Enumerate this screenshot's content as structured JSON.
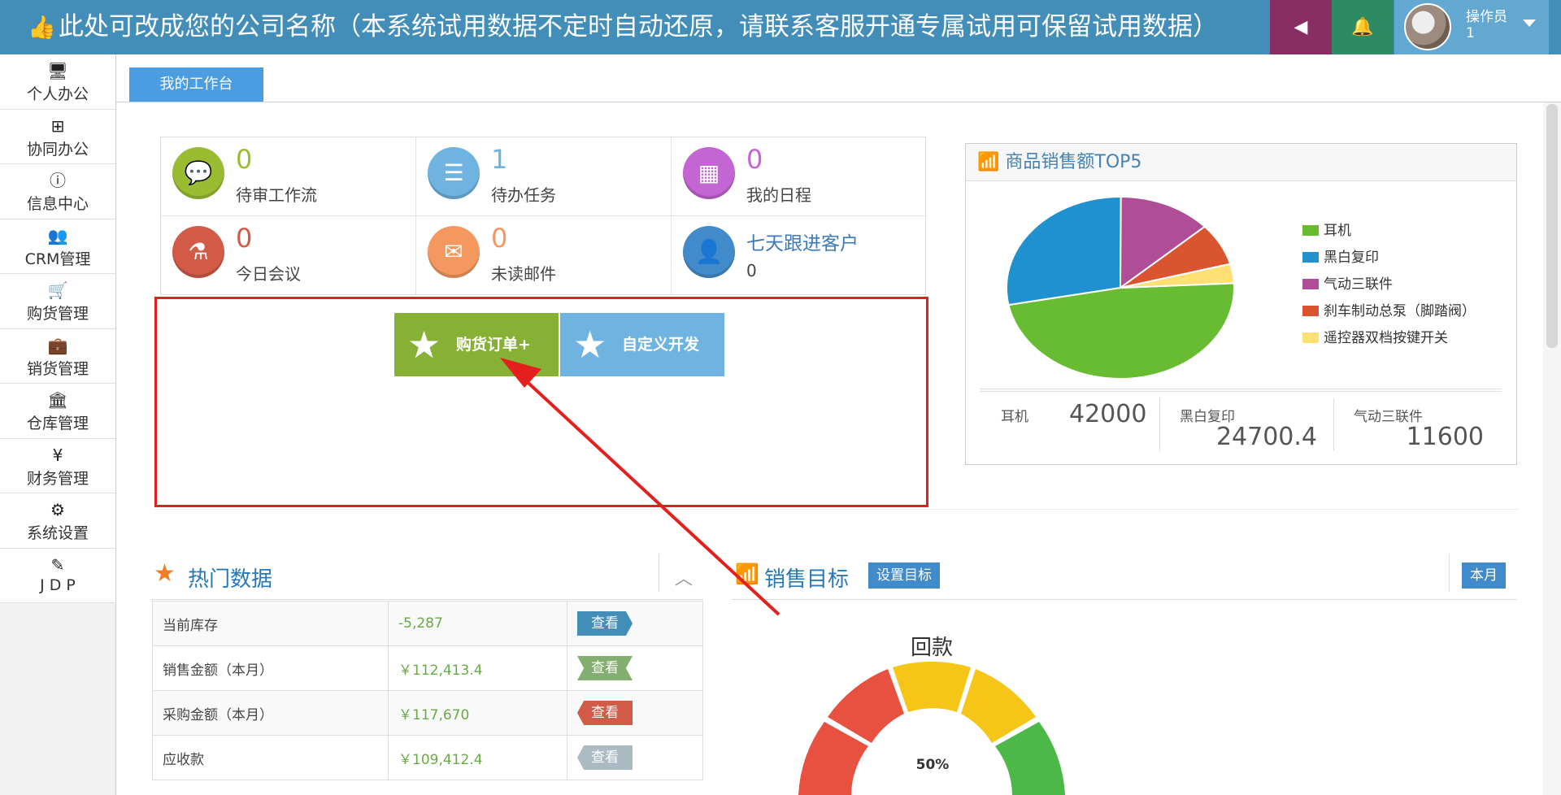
{
  "header": {
    "title": "此处可改成您的公司名称（本系统试用数据不定时自动还原，请联系客服开通专属试用可保留试用数据）",
    "user_name": "操作员",
    "user_id": "1"
  },
  "sidebar": {
    "items": [
      {
        "label": "个人办公",
        "icon": "monitor-icon"
      },
      {
        "label": "协同办公",
        "icon": "sitemap-icon"
      },
      {
        "label": "信息中心",
        "icon": "info-icon"
      },
      {
        "label": "CRM管理",
        "icon": "users-icon"
      },
      {
        "label": "购货管理",
        "icon": "cart-icon"
      },
      {
        "label": "销货管理",
        "icon": "briefcase-icon"
      },
      {
        "label": "仓库管理",
        "icon": "bank-icon"
      },
      {
        "label": "财务管理",
        "icon": "yen-icon"
      },
      {
        "label": "系统设置",
        "icon": "gear-icon"
      },
      {
        "label": "J D P",
        "icon": "edit-icon"
      }
    ]
  },
  "tabs": [
    {
      "label": "我的工作台"
    }
  ],
  "stats": [
    {
      "value": "0",
      "label": "待审工作流",
      "color": "#9abc32"
    },
    {
      "value": "1",
      "label": "待办任务",
      "color": "#6fb3e0"
    },
    {
      "value": "0",
      "label": "我的日程",
      "color": "#c365d2"
    },
    {
      "value": "0",
      "label": "今日会议",
      "color": "#d15b47"
    },
    {
      "value": "0",
      "label": "未读邮件",
      "color": "#f49860"
    },
    {
      "value": "0",
      "label": "七天跟进客户",
      "color": "#428bca"
    }
  ],
  "quick": {
    "purchase_order": "购货订单+",
    "custom_dev": "自定义开发"
  },
  "top5": {
    "title": "商品销售额TOP5",
    "metrics": [
      {
        "name": "耳机",
        "value": "42000"
      },
      {
        "name": "黑白复印",
        "value": "24700.4"
      },
      {
        "name": "气动三联件",
        "value": "11600"
      }
    ]
  },
  "chart_data": {
    "type": "pie",
    "categories": [
      "耳机",
      "黑白复印",
      "气动三联件",
      "刹车制动总泵（脚踏阀）",
      "遥控器双档按键开关"
    ],
    "values": [
      42000,
      24700.4,
      11600,
      6600,
      3000
    ],
    "colors": [
      "#68bc31",
      "#2091cf",
      "#af4e96",
      "#da5430",
      "#fee074"
    ],
    "legend": "right"
  },
  "hot": {
    "title": "热门数据",
    "rows": [
      {
        "name": "当前库存",
        "value": "-5,287",
        "action": "查看"
      },
      {
        "name": "销售金额（本月）",
        "value": "￥112,413.4",
        "action": "查看"
      },
      {
        "name": "采购金额（本月）",
        "value": "￥117,670",
        "action": "查看"
      },
      {
        "name": "应收款",
        "value": "￥109,412.4",
        "action": "查看"
      }
    ]
  },
  "sales_target": {
    "title": "销售目标",
    "set_button": "设置目标",
    "period_button": "本月",
    "gauge_title": "回款",
    "gauge_value": "50%"
  }
}
